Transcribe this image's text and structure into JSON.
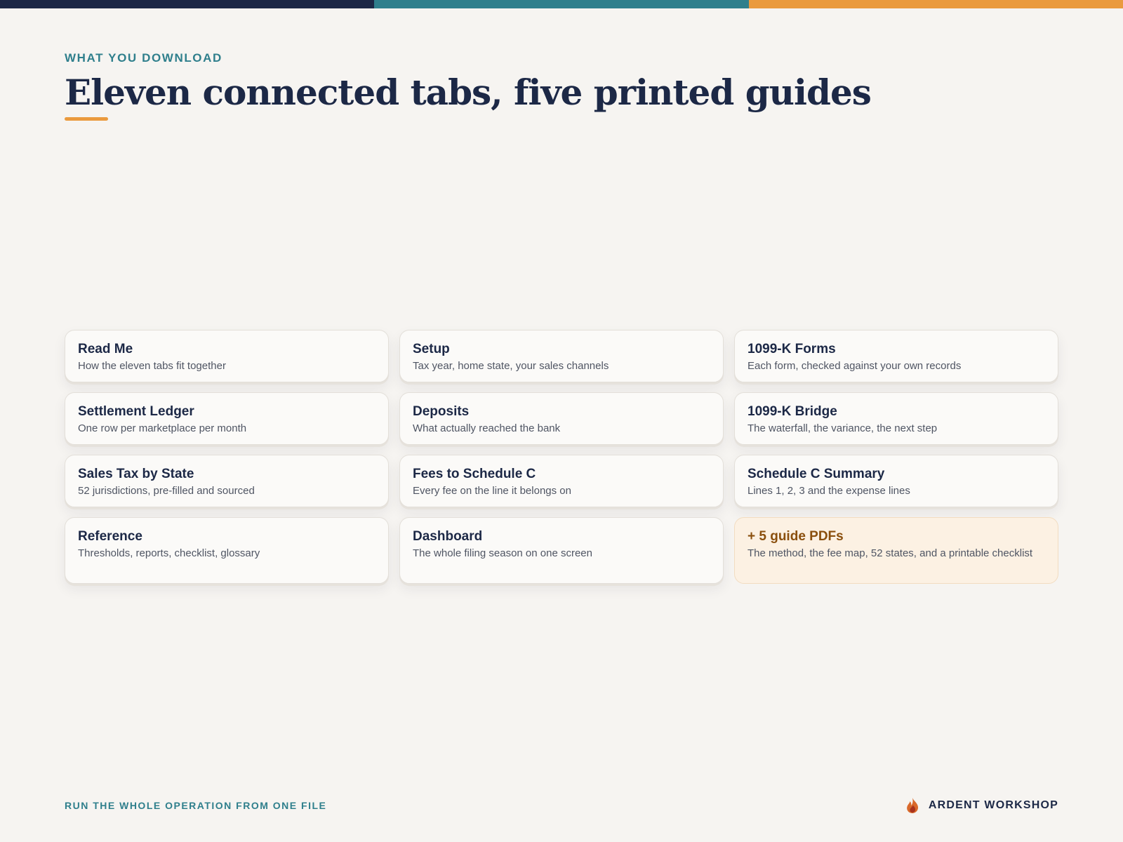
{
  "colors": {
    "navy": "#1c2846",
    "teal": "#2f7f8c",
    "orange": "#ea9a3e",
    "background": "#f6f4f1",
    "guide_title": "#8a4f0d"
  },
  "top_stripe": [
    "#1c2846",
    "#2f7f8c",
    "#ea9a3e"
  ],
  "header": {
    "eyebrow": "WHAT YOU DOWNLOAD",
    "title": "Eleven connected tabs, five printed guides"
  },
  "cards": [
    {
      "title": "Read Me",
      "description": "How the eleven tabs fit together"
    },
    {
      "title": "Setup",
      "description": "Tax year, home state, your sales channels"
    },
    {
      "title": "1099-K Forms",
      "description": "Each form, checked against your own records"
    },
    {
      "title": "Settlement Ledger",
      "description": "One row per marketplace per month"
    },
    {
      "title": "Deposits",
      "description": "What actually reached the bank"
    },
    {
      "title": "1099-K Bridge",
      "description": "The waterfall, the variance, the next step"
    },
    {
      "title": "Sales Tax by State",
      "description": "52 jurisdictions, pre-filled and sourced"
    },
    {
      "title": "Fees to Schedule C",
      "description": "Every fee on the line it belongs on"
    },
    {
      "title": "Schedule C Summary",
      "description": "Lines 1, 2, 3 and the expense lines"
    },
    {
      "title": "Reference",
      "description": "Thresholds, reports, checklist, glossary"
    },
    {
      "title": "Dashboard",
      "description": "The whole filing season on one screen"
    },
    {
      "title": "+ 5 guide PDFs",
      "description": "The method, the fee map, 52 states, and a printable checklist"
    }
  ],
  "footer": {
    "tagline": "RUN THE WHOLE OPERATION FROM ONE FILE",
    "brand_icon": "flame-icon",
    "brand_name": "ARDENT WORKSHOP"
  }
}
